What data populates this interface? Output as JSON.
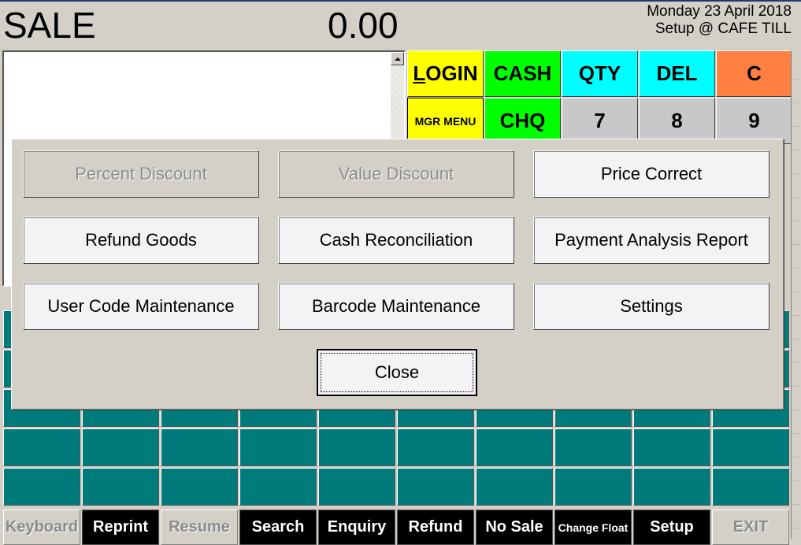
{
  "header": {
    "mode": "SALE",
    "total": "0.00",
    "date": "Monday 23 April 2018",
    "user_location": "Setup @ CAFE TILL"
  },
  "item_list": {
    "items": []
  },
  "keypad": {
    "keys": [
      {
        "label": "LOGIN",
        "underline": "L",
        "color": "#ffff00"
      },
      {
        "label": "CASH",
        "color": "#00ff00"
      },
      {
        "label": "QTY",
        "color": "#00ffff"
      },
      {
        "label": "DEL",
        "color": "#00ffff"
      },
      {
        "label": "C",
        "color": "#ff8040"
      },
      {
        "label": "MGR MENU",
        "color": "#ffff00"
      },
      {
        "label": "CHQ",
        "color": "#00ff00"
      },
      {
        "label": "7",
        "color": "#c8c8c8"
      },
      {
        "label": "8",
        "color": "#c8c8c8"
      },
      {
        "label": "9",
        "color": "#c8c8c8"
      }
    ]
  },
  "product_grid": {
    "color": "#007b7b",
    "rows": 5,
    "cols": 10
  },
  "bottom_bar": {
    "buttons": [
      {
        "label": "Keyboard",
        "enabled": false
      },
      {
        "label": "Reprint",
        "enabled": true
      },
      {
        "label": "Resume",
        "enabled": false
      },
      {
        "label": "Search",
        "enabled": true
      },
      {
        "label": "Enquiry",
        "enabled": true
      },
      {
        "label": "Refund",
        "enabled": true
      },
      {
        "label": "No Sale",
        "enabled": true
      },
      {
        "label": "Change Float",
        "enabled": true
      },
      {
        "label": "Setup",
        "enabled": true
      },
      {
        "label": "EXIT",
        "enabled": false
      }
    ]
  },
  "manager_menu": {
    "buttons": [
      {
        "label": "Percent Discount",
        "enabled": false
      },
      {
        "label": "Value Discount",
        "enabled": false
      },
      {
        "label": "Price Correct",
        "enabled": true
      },
      {
        "label": "Refund Goods",
        "enabled": true
      },
      {
        "label": "Cash Reconciliation",
        "enabled": true
      },
      {
        "label": "Payment Analysis Report",
        "enabled": true
      },
      {
        "label": "User Code Maintenance",
        "enabled": true
      },
      {
        "label": "Barcode Maintenance",
        "enabled": true
      },
      {
        "label": "Settings",
        "enabled": true
      }
    ],
    "close_label": "Close"
  }
}
